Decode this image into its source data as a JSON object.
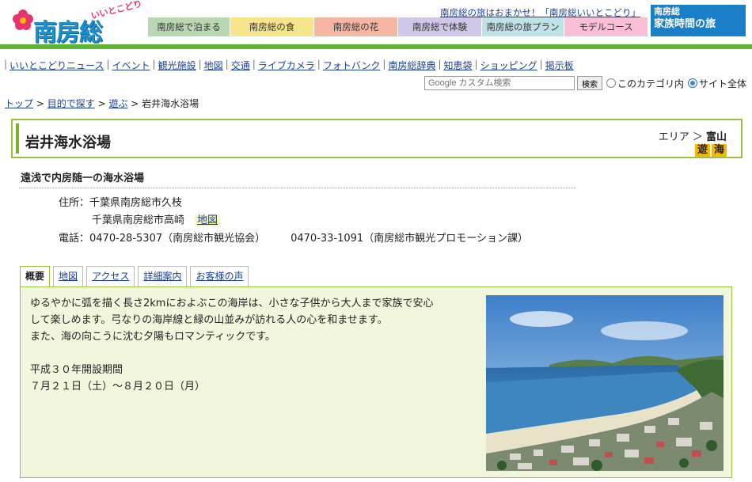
{
  "header": {
    "logo_tagline": "いいとこどり",
    "logo_text": "南房総",
    "tagline": "南房総の旅はおまかせ！「南房総いいとこどり」",
    "banner_line1": "南房総",
    "banner_line2": "家族時間の旅"
  },
  "nav_tabs": [
    {
      "label": "南房総で泊まる",
      "color": "#b9d8b2",
      "width": 104
    },
    {
      "label": "南房総の食",
      "color": "#f6e58a",
      "width": 106
    },
    {
      "label": "南房総の花",
      "color": "#f6b7a2",
      "width": 106
    },
    {
      "label": "南房総で体験",
      "color": "#cfc6e8",
      "width": 106
    },
    {
      "label": "南房総の旅プラン",
      "color": "#bfe2e8",
      "width": 104
    },
    {
      "label": "モデルコース",
      "color": "#f8bfd6",
      "width": 106
    }
  ],
  "sub_nav": [
    "いいとこどりニュース",
    "イベント",
    "観光施設",
    "地図",
    "交通",
    "ライブカメラ",
    "フォトバンク",
    "南房総辞典",
    "知恵袋",
    "ショッピング",
    "掲示板"
  ],
  "search": {
    "placeholder": "Google カスタム検索",
    "button": "検索",
    "radio_category": "このカテゴリ内",
    "radio_site": "サイト全体"
  },
  "breadcrumb": {
    "top": "トップ",
    "purpose": "目的で探す",
    "play": "遊ぶ",
    "current": "岩井海水浴場"
  },
  "title": {
    "name": "岩井海水浴場",
    "area_label": "エリア ＞ ",
    "area_value": "富山",
    "cat1": "遊",
    "cat2": "海"
  },
  "subtitle": "遠浅で内房随一の海水浴場",
  "info": {
    "address_label": "住所：",
    "address1": "千葉県南房総市久枝",
    "address2": "千葉県南房総市高崎",
    "map_link": "地図",
    "phone_label": "電話：",
    "phone1": "0470-28-5307（南房総市観光協会）",
    "phone2": "0470-33-1091（南房総市観光プロモーション課）"
  },
  "tabs": [
    "概要",
    "地図",
    "アクセス",
    "詳細案内",
    "お客様の声"
  ],
  "description": {
    "line1": "ゆるやかに弧を描く長さ2kmにおよぶこの海岸は、小さな子供から大人まで家族で安心",
    "line2": "して楽しめます。弓なりの海岸線と緑の山並みが訪れる人の心を和ませます。",
    "line3": "また、海の向こうに沈む夕陽もロマンティックです。",
    "period_label": "平成３０年開設期間",
    "period": "７月２１日（土）～８月２０日（月）"
  }
}
